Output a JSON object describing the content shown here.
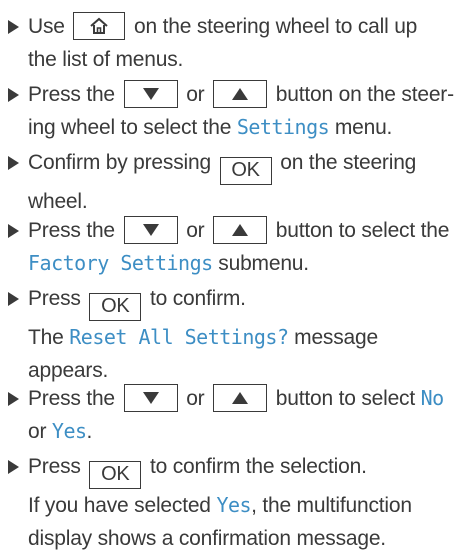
{
  "keys": {
    "ok": "OK",
    "home": "home-icon",
    "down": "down-triangle-icon",
    "up": "up-triangle-icon"
  },
  "colors": {
    "highlight": "#3d8ec4",
    "text": "#3a3a3a"
  },
  "steps": [
    {
      "a": "Use",
      "b": "on the steering wheel to call up",
      "c": "the list of menus."
    },
    {
      "a": "Press the",
      "b": "or",
      "c": "button on the steer-",
      "d": "ing wheel to select the",
      "hl": "Settings",
      "e": "menu."
    },
    {
      "a": "Confirm by pressing",
      "b": "on the steering",
      "c": "wheel."
    },
    {
      "a": "Press the",
      "b": "or",
      "c": "button to select the",
      "hl": "Factory Settings",
      "d": "submenu."
    },
    {
      "a": "Press",
      "b": "to confirm.",
      "c": "The",
      "hl": "Reset All Settings?",
      "d": "message",
      "e": "appears."
    },
    {
      "a": "Press the",
      "b": "or",
      "c": "button to select",
      "hl1": "No",
      "d": "or",
      "hl2": "Yes",
      "e": "."
    },
    {
      "a": "Press",
      "b": "to confirm the selection.",
      "c": "If you have selected",
      "hl": "Yes",
      "d": ", the multifunction",
      "e": "display shows a confirmation message."
    }
  ]
}
